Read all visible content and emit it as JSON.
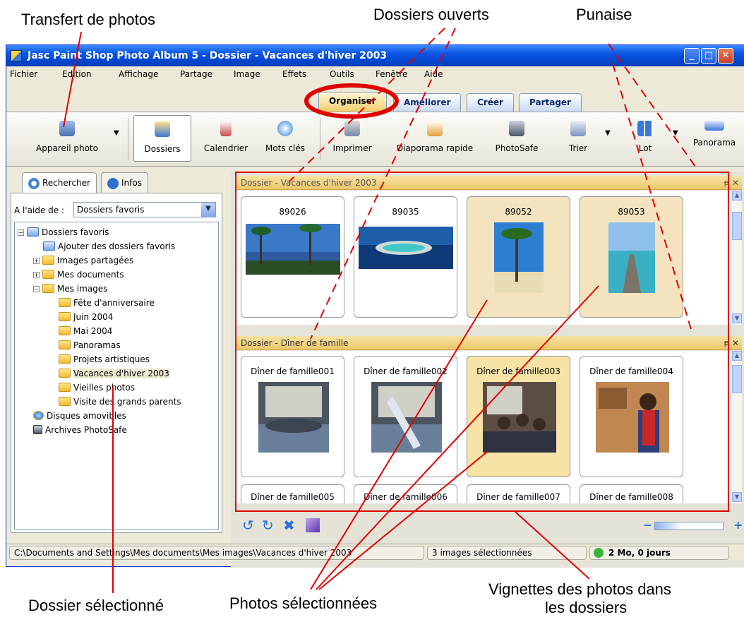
{
  "callouts": {
    "transfert": "Transfert de photos",
    "dossiers_ouverts": "Dossiers ouverts",
    "punaise": "Punaise",
    "dossier_selectionne": "Dossier sélectionné",
    "photos_selectionnees": "Photos sélectionnées",
    "vignettes_line1": "Vignettes des photos dans",
    "vignettes_line2": "les dossiers"
  },
  "window": {
    "title": "Jasc Paint Shop Photo Album 5 - Dossier - Vacances d'hiver 2003",
    "minimize_icon": "minimize-icon",
    "maximize_icon": "maximize-icon",
    "close_icon": "close-icon"
  },
  "menu": [
    "Fichier",
    "Edition",
    "Affichage",
    "Partage",
    "Image",
    "Effets",
    "Outils",
    "Fenêtre",
    "Aide"
  ],
  "tabs": [
    "Organiser",
    "Améliorer",
    "Créer",
    "Partager"
  ],
  "active_tab": "Organiser",
  "toolbar": {
    "appareil": "Appareil photo",
    "dossiers": "Dossiers",
    "calendrier": "Calendrier",
    "mots_cles": "Mots clés",
    "imprimer": "Imprimer",
    "diaporama": "Diaporama rapide",
    "photosafe": "PhotoSafe",
    "trier": "Trier",
    "lot": "Lot",
    "panorama": "Panorama"
  },
  "left": {
    "tab_rechercher": "Rechercher",
    "tab_infos": "Infos",
    "aide_label": "A l'aide de :",
    "combo_value": "Dossiers favoris",
    "tree": [
      "Dossiers favoris",
      "Ajouter des dossiers favoris",
      "Images partagées",
      "Mes documents",
      "Mes images",
      "Fête d'anniversaire",
      "Juin 2004",
      "Mai 2004",
      "Panoramas",
      "Projets artistiques",
      "Vacances d'hiver 2003",
      "Vieilles photos",
      "Visite des grands parents",
      "Disques amovibles",
      "Archives PhotoSafe"
    ]
  },
  "folders": {
    "vacances": {
      "title": "Dossier - Vacances d'hiver 2003",
      "photos": [
        "89026",
        "89035",
        "89052",
        "89053"
      ]
    },
    "diner": {
      "title": "Dossier - Dîner de famille",
      "photos": [
        "Dîner de famille001",
        "Dîner de famille002",
        "Dîner de famille003",
        "Dîner de famille004",
        "Dîner de famille005",
        "Dîner de famille006",
        "Dîner de famille007",
        "Dîner de famille008"
      ]
    }
  },
  "status": {
    "path": "C:\\Documents and Settings\\Mes documents\\Mes images\\Vacances d'hiver 2003",
    "selection": "3 images sélectionnées",
    "storage": "2 Mo, 0 jours"
  },
  "colors": {
    "title_blue": "#0a55e4",
    "folder_bar": "#ebc868",
    "selected_card": "#f3e4bf",
    "annotation_red": "#e00000"
  }
}
